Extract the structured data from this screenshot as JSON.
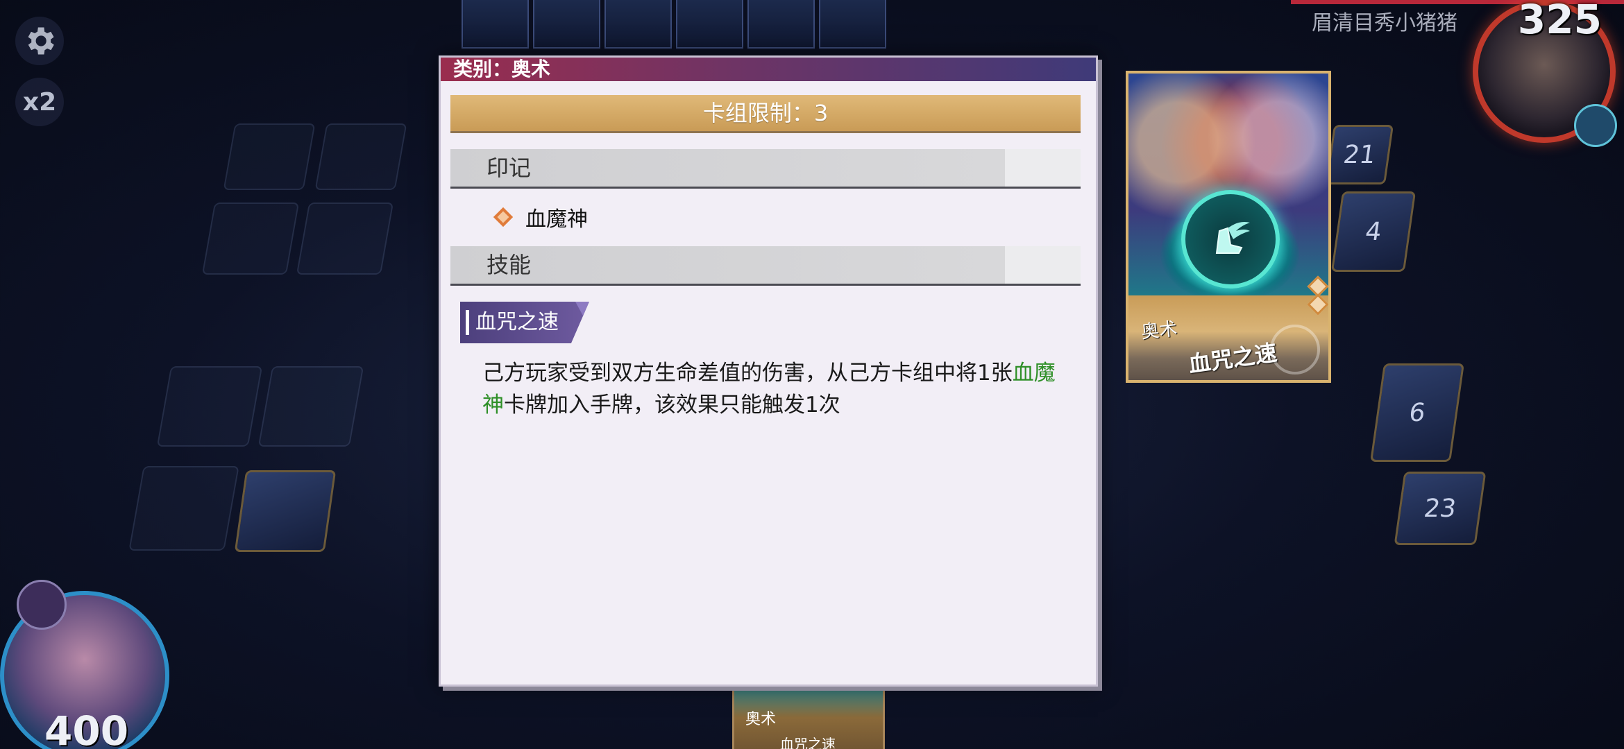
{
  "hud": {
    "speed_label": "x2",
    "opponent_name": "眉清目秀小猪猪",
    "opponent_hp": "325",
    "player_hp": "400"
  },
  "board": {
    "right_stack_counts": [
      "21",
      "4",
      "6",
      "23"
    ]
  },
  "hand": {
    "card_type": "奥术",
    "card_name": "血咒之速"
  },
  "detail": {
    "header": "类别：奥术",
    "deck_limit": "卡组限制：3",
    "mark_section": "印记",
    "mark_name": "血魔神",
    "skill_section": "技能",
    "skill_name": "血咒之速",
    "skill_desc_part1": "己方玩家受到双方生命差值的伤害，从己方卡组中将1张",
    "skill_desc_highlight": "血魔神",
    "skill_desc_part2": "卡牌加入手牌，该效果只能触发1次"
  },
  "card_preview": {
    "type": "奥术",
    "name": "血咒之速"
  },
  "colors": {
    "header_gradient_start": "#9a2d4e",
    "header_gradient_end": "#3f3a79",
    "deck_limit_gold": "#d4aa68",
    "highlight_green": "#2e8f27",
    "mark_diamond": "#e07b3a",
    "skill_tag_purple": "#5a4a8c"
  },
  "icons": [
    "gear-icon",
    "seal-diamond-icon",
    "winged-boot-icon"
  ]
}
